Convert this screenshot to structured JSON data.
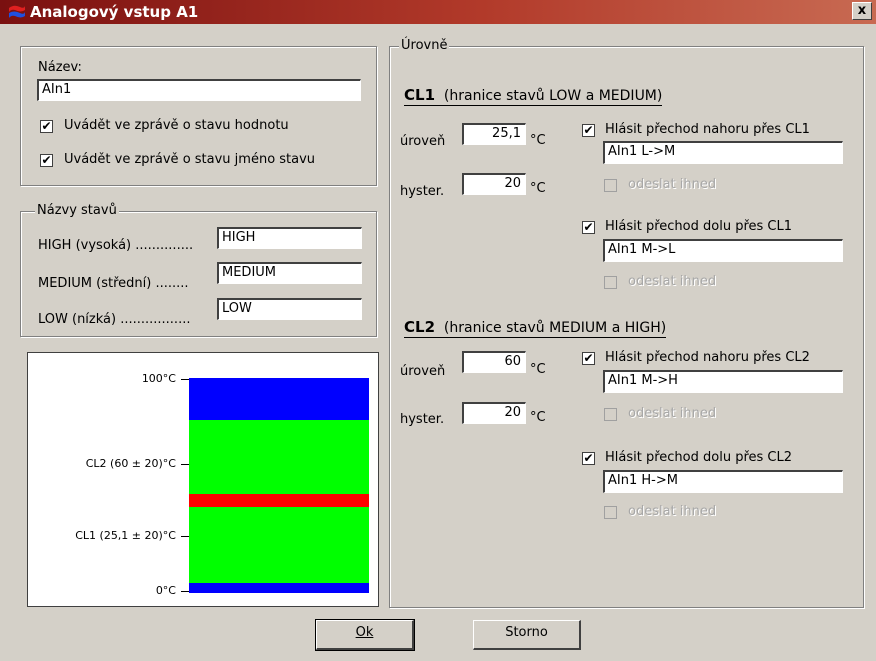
{
  "window": {
    "title": "Analogový vstup A1",
    "close_label": "x"
  },
  "name_group": {
    "label": "Název:",
    "value": "AIn1",
    "report_value": {
      "label": "Uvádět ve zprávě o stavu hodnotu",
      "checked": true
    },
    "report_state_name": {
      "label": "Uvádět ve zprávě o stavu jméno stavu",
      "checked": true
    }
  },
  "state_names": {
    "title": "Názvy stavů",
    "high": {
      "label": "HIGH (vysoká) ..............",
      "value": "HIGH"
    },
    "medium": {
      "label": "MEDIUM (střední) ........",
      "value": "MEDIUM"
    },
    "low": {
      "label": "LOW (nízká) .................",
      "value": "LOW"
    }
  },
  "levels": {
    "title": "Úrovně",
    "cl1": {
      "title_bold": "CL1",
      "title_rest": "(hranice stavů LOW a MEDIUM)",
      "level_label": "úroveň",
      "level_value": "25,1",
      "level_unit": "°C",
      "hyster_label": "hyster.",
      "hyster_value": "20",
      "hyster_unit": "°C",
      "up": {
        "label": "Hlásit přechod nahoru přes CL1",
        "checked": true,
        "message": "AIn1 L->M",
        "send_now": "odeslat ihned"
      },
      "down": {
        "label": "Hlásit přechod dolu přes CL1",
        "checked": true,
        "message": "AIn1 M->L",
        "send_now": "odeslat ihned"
      }
    },
    "cl2": {
      "title_bold": "CL2",
      "title_rest": "(hranice stavů MEDIUM a HIGH)",
      "level_label": "úroveň",
      "level_value": "60",
      "level_unit": "°C",
      "hyster_label": "hyster.",
      "hyster_value": "20",
      "hyster_unit": "°C",
      "up": {
        "label": "Hlásit přechod nahoru přes CL2",
        "checked": true,
        "message": "AIn1 M->H",
        "send_now": "odeslat ihned"
      },
      "down": {
        "label": "Hlásit přechod dolu přes CL2",
        "checked": true,
        "message": "AIn1 H->M",
        "send_now": "odeslat ihned"
      }
    }
  },
  "scale": {
    "ticks": [
      "100°C",
      "CL2 (60 ± 20)°C",
      "CL1 (25,1 ± 20)°C",
      "0°C"
    ],
    "colors": {
      "high": "#0000ff",
      "medium": "#00ff00",
      "cl_marker": "#ff0000"
    }
  },
  "buttons": {
    "ok": "Ok",
    "cancel": "Storno"
  },
  "check_mark": "✔"
}
